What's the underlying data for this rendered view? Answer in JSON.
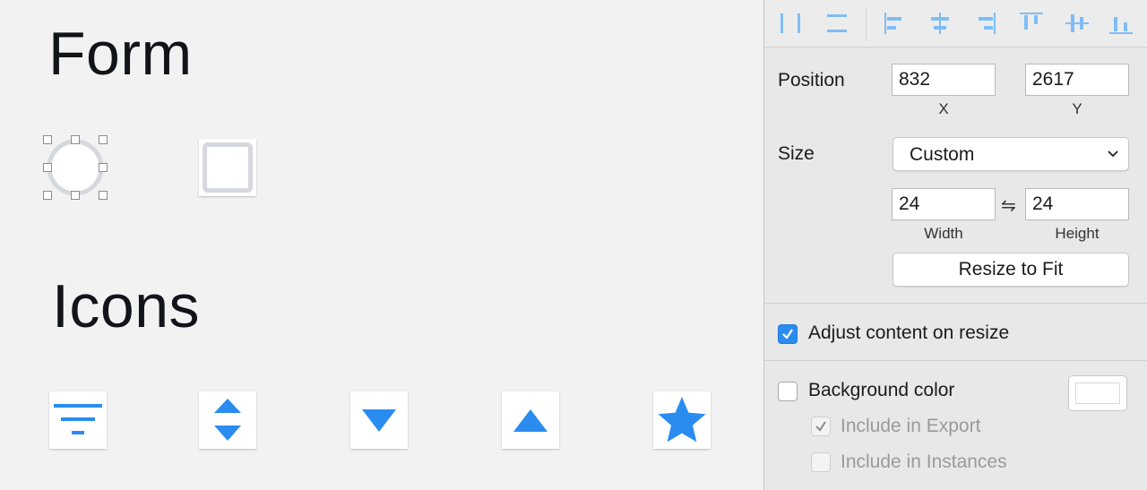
{
  "canvas": {
    "form_title": "Form",
    "icons_title": "Icons",
    "icons": [
      "filter-icon",
      "sort-arrows-icon",
      "triangle-down-icon",
      "triangle-up-icon",
      "star-icon"
    ],
    "accent": "#2b8cf0"
  },
  "inspector": {
    "position_label": "Position",
    "x_value": "832",
    "y_value": "2617",
    "x_label": "X",
    "y_label": "Y",
    "size_label": "Size",
    "size_preset": "Custom",
    "width_value": "24",
    "height_value": "24",
    "width_label": "Width",
    "height_label": "Height",
    "link_glyph": "⇋",
    "resize_button": "Resize to Fit",
    "adjust_content": {
      "label": "Adjust content on resize",
      "checked": true
    },
    "background_color": {
      "label": "Background color",
      "checked": false,
      "swatch": "#ffffff"
    },
    "include_export": {
      "label": "Include in Export",
      "checked": true,
      "disabled": true
    },
    "include_instances": {
      "label": "Include in Instances",
      "checked": false,
      "disabled": true
    }
  }
}
